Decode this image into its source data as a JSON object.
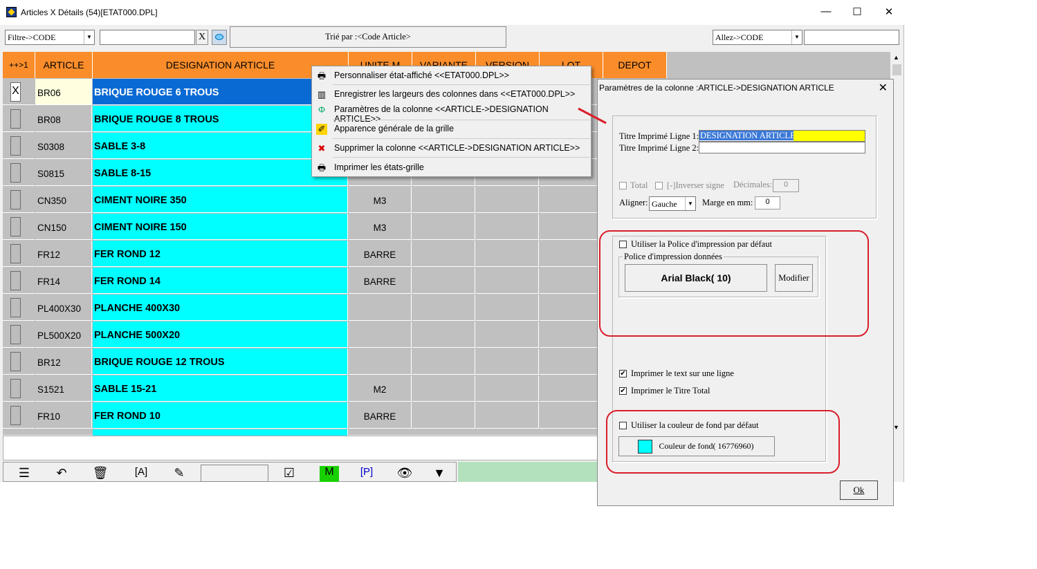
{
  "window": {
    "title": "Articles X Détails (54)[ETAT000.DPL]",
    "min": "—",
    "max": "☐",
    "close": "✕"
  },
  "toolbar": {
    "filter_combo": "Filtre->CODE",
    "filter_value": "",
    "clear_label": "X",
    "sort_label": "Trié par :<Code Article>",
    "goto_combo": "Allez->CODE",
    "goto_value": ""
  },
  "grid": {
    "headers": [
      "++>1",
      "ARTICLE",
      "DESIGNATION ARTICLE",
      "UNITE M",
      "VARIANTE",
      "VERSION",
      "LOT",
      "DEPOT"
    ],
    "rows": [
      {
        "code": "BR06",
        "designation": "BRIQUE ROUGE 6 TROUS",
        "unit": "",
        "mark": "X"
      },
      {
        "code": "BR08",
        "designation": "BRIQUE ROUGE 8 TROUS",
        "unit": ""
      },
      {
        "code": "S0308",
        "designation": "SABLE 3-8",
        "unit": ""
      },
      {
        "code": "S0815",
        "designation": "SABLE 8-15",
        "unit": ""
      },
      {
        "code": "CN350",
        "designation": "CIMENT NOIRE 350",
        "unit": "M3"
      },
      {
        "code": "CN150",
        "designation": "CIMENT NOIRE 150",
        "unit": "M3"
      },
      {
        "code": "FR12",
        "designation": "FER ROND 12",
        "unit": "BARRE"
      },
      {
        "code": "FR14",
        "designation": "FER ROND 14",
        "unit": "BARRE"
      },
      {
        "code": "PL400X30",
        "designation": "PLANCHE 400X30",
        "unit": ""
      },
      {
        "code": "PL500X20",
        "designation": "PLANCHE 500X20",
        "unit": ""
      },
      {
        "code": "BR12",
        "designation": "BRIQUE ROUGE 12 TROUS",
        "unit": ""
      },
      {
        "code": "S1521",
        "designation": "SABLE 15-21",
        "unit": "M2"
      },
      {
        "code": "FR10",
        "designation": "FER ROND 10",
        "unit": "BARRE"
      }
    ]
  },
  "context_menu": {
    "items": [
      {
        "label": "Personnaliser état-affiché <<ETAT000.DPL>>",
        "icon": "printer-settings-icon"
      },
      {
        "label": "Enregistrer les largeurs des colonnes dans <<ETAT000.DPL>>",
        "icon": "save-columns-icon"
      },
      {
        "label": "Paramètres de la colonne <<ARTICLE->DESIGNATION ARTICLE>>",
        "icon": "column-settings-icon"
      },
      {
        "label": "Apparence générale de la grille",
        "icon": "paint-icon"
      },
      {
        "label": "Supprimer la colonne <<ARTICLE->DESIGNATION ARTICLE>>",
        "icon": "delete-column-icon"
      },
      {
        "label": "Imprimer les états-grille",
        "icon": "printer-icon"
      }
    ]
  },
  "dialog": {
    "title": "Paramètres de la colonne :ARTICLE->DESIGNATION ARTICLE",
    "close": "✕",
    "title_line1_label": "Titre Imprimé Ligne 1:",
    "title_line1_value": "DESIGNATION ARTICLE",
    "title_line2_label": "Titre Imprimé Ligne 2:",
    "title_line2_value": "",
    "total_label": "Total",
    "inverse_label": "[-]Inverser signe",
    "decimals_label": "Décimales:",
    "decimals_value": "0",
    "align_label": "Aligner:",
    "align_value": "Gauche",
    "margin_label": "Marge en mm:",
    "margin_value": "0",
    "use_default_font_label": "Utiliser la Police d'impression par défaut",
    "font_group_label": "Police d'impression  données",
    "font_value": "Arial Black( 10)",
    "modify_label": "Modifier",
    "print_one_line_label": "Imprimer le text sur une ligne",
    "print_total_title_label": "Imprimer le Titre Total",
    "use_default_bg_label": "Utiliser la couleur de fond  par défaut",
    "bg_color_label": "Couleur de fond( 16776960)",
    "ok_label": "Ok"
  },
  "colors": {
    "header": "#fa8d2a",
    "designation_bg": "#00ffff",
    "selected_row": "#0a6ad4",
    "highlight": "#ffff00",
    "annotation": "#d91d2a"
  }
}
